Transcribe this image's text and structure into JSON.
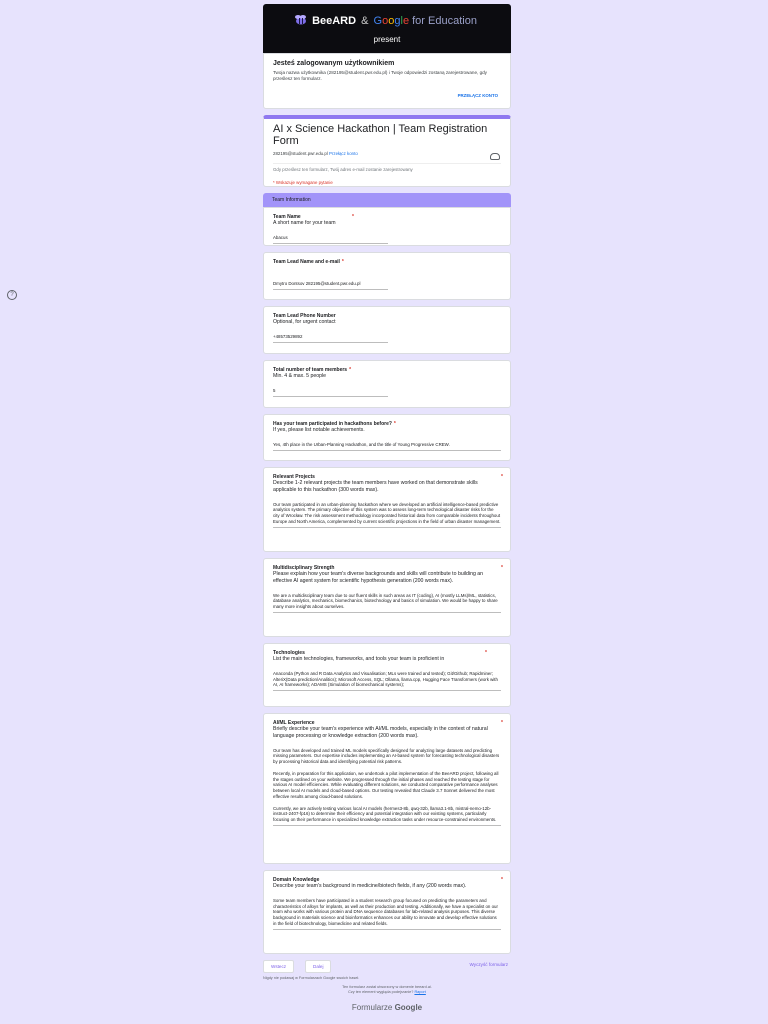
{
  "banner": {
    "brand": "BeeARD",
    "amp": "&",
    "google_letters": [
      "G",
      "o",
      "o",
      "g",
      "l",
      "e"
    ],
    "edu": "for Education",
    "present": "present"
  },
  "login": {
    "heading": "Jesteś zalogowanym użytkownikiem",
    "text": "Twoja nazwa użytkownika (282195@student.pwr.edu.pl) i Twoje odpowiedzi zostaną zarejestrowane, gdy prześlesz ten formularz.",
    "switch": "PRZEŁĄCZ KONTO"
  },
  "form": {
    "title": "AI x Science Hackathon | Team Registration Form",
    "email": "282195@student.pwr.edu.pl",
    "switch_link": "Przełącz konto",
    "note": "Gdy prześlesz ten formularz, Twój adres e-mail zostanie zarejestrowany",
    "required_note": "* Wskazuje wymagane pytanie"
  },
  "section_title": "Team Information",
  "questions": {
    "team_name": {
      "label": "Team Name",
      "desc": "A short name for your team",
      "answer": "Abacus"
    },
    "team_lead": {
      "label": "Team Lead Name and e-mail",
      "answer": "Dmytro Dontsov 282195@student.pwr.edu.pl"
    },
    "phone": {
      "label": "Team Lead Phone Number",
      "desc": "Optional, for urgent contact",
      "answer": "+48573529892"
    },
    "members": {
      "label": "Total number of team members",
      "desc": "Min. 4 & max. 5 people",
      "answer": "5"
    },
    "hackathons": {
      "label": "Has your team participated in hackathons before?",
      "desc": "If yes, please list notable achievements.",
      "answer": "Yes, 4th place in the Urban-Planning Hackathon, and the title of Young Progressive CREW."
    },
    "projects": {
      "label": "Relevant Projects",
      "desc": "Describe 1-2 relevant projects the team members have worked on that demonstrate skills applicable to this hackathon (300 words max).",
      "answer": "Our team participated in an urban-planning hackathon where we developed an artificial intelligence-based predictive analytics system. The primary objective of this system was to assess long-term technological disaster risks for the city of Wrocław. The risk assessment methodology incorporated historical data from comparable incidents throughout Europe and North America, complemented by current scientific projections in the field of urban disaster management."
    },
    "multi": {
      "label": "Multidisciplinary Strength",
      "desc": "Please explain how your team's diverse backgrounds and skills will contribute to building an effective AI agent system for scientific hypothesis generation (200 words max).",
      "answer": "We are a multidisciplinary team due to our fluent skills in such areas as IT (coding), AI (mostly LLMs)/ML, statistics, database analytics, mechanics, biomechanics, biotechnology and basics of simulation. We would be happy to share many more insights about ourselves."
    },
    "tech": {
      "label": "Technologies",
      "desc": "List the main technologies, frameworks, and tools your team is proficient in",
      "answer": "Anaconda (Python and R Data Analytics and Visualisation; MLs were trained and tested); Git/Github; Rapidminer; AlteriX(Data prediction/Analitics); Microsoft Access, SQL; Ollama, llama.cpp, Hugging Face Transformers (work with AI, AI frameworks); ADAMS (Simulation of biomechanical systems);"
    },
    "aiml": {
      "label": "AI/ML Experience",
      "desc": "Briefly describe your team's experience with AI/ML models, especially in the context of natural language processing or knowledge extraction (200 words max).",
      "answer_paragraphs": [
        "Our team has developed and trained ML models specifically designed for analyzing large datasets and predicting missing parameters. Our expertise includes implementing an AI-based system for forecasting technological disasters by processing historical data and identifying potential risk patterns.",
        "Recently, in preparation for this application, we undertook a pilot implementation of the BeeARD project, following all the stages outlined on your website. We progressed through the initial phases and reached the testing stage for various AI model efficiencies. While evaluating different solutions, we conducted comparative performance analyses between local AI models and cloud-based options. Our testing revealed that Claude 3.7 Sonnet delivered the most effective results among cloud-based solutions.",
        "Currently, we are actively testing various local AI models (hermes3-8b, qwq-32b, llama3.1-8b, mistral-nemo-12b-instruct-2407-fp16) to determine their efficiency and potential integration with our existing systems, particularly focusing on their performance in specialized knowledge extraction tasks under resource-constrained environments."
      ]
    },
    "domain": {
      "label": "Domain Knowledge",
      "desc": "Describe your team's background in medicine/biotech fields, if any (200 words max).",
      "answer": "Some team members have participated in a student research group focused on predicting the parameters and characteristics of alloys for implants, as well as their production and testing. Additionally, we have a specialist on our team who works with various protein and DNA sequence databases for lab-related analysis purposes. This diverse background in materials science and bioinformatics enhances our ability to innovate and develop effective solutions in the field of biotechnology, biomedicine and related fields."
    }
  },
  "nav": {
    "back": "Wstecz",
    "next": "Dalej",
    "clear": "Wyczyść formularz"
  },
  "footer": {
    "never": "Nigdy nie podawaj w Formularzach Google swoich haseł.",
    "created": "Ten formularz został utworzony w domenie beeard.ai.",
    "suspicious": "Czy ten element wygląda podejrzanie?",
    "report": "Raport",
    "brand": "Formularze",
    "brand_google": "Google"
  }
}
